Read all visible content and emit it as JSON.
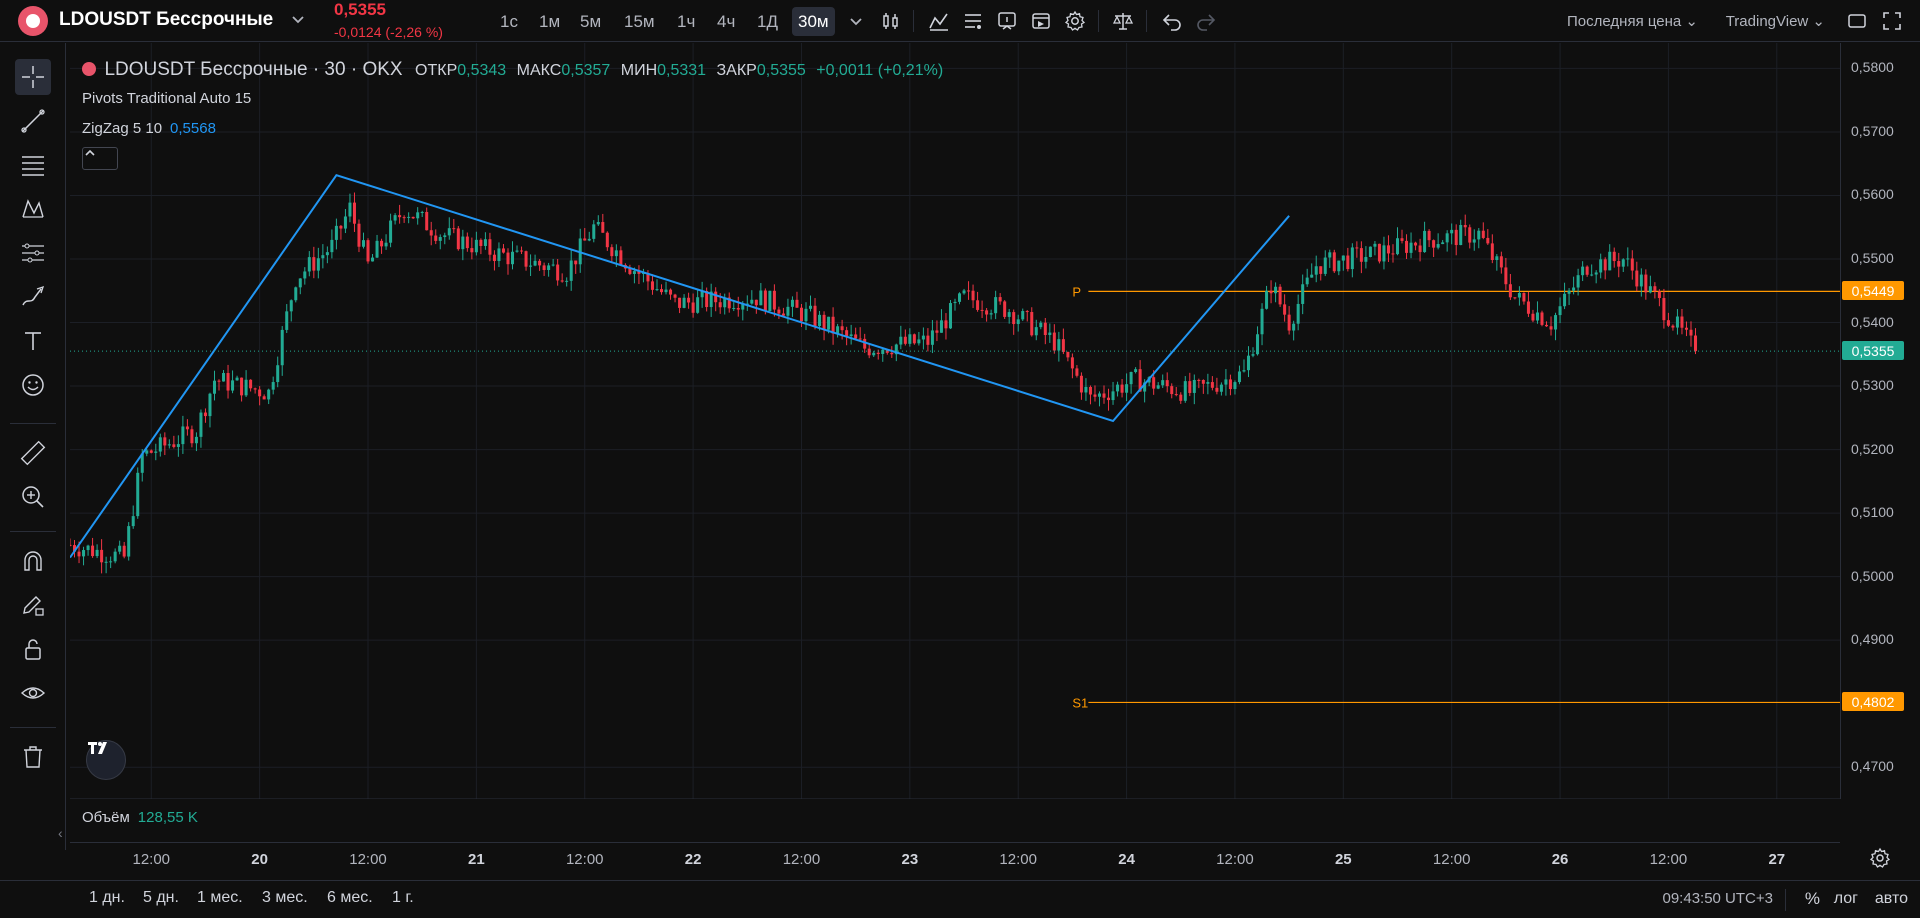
{
  "header": {
    "symbol": "LDOUSDT Бессрочные",
    "last_price": "0,5355",
    "price_change": "-0,0124 (-2,26 %)",
    "timeframes": [
      "1с",
      "1м",
      "5м",
      "15м",
      "1ч",
      "4ч",
      "1Д",
      "30м"
    ],
    "active_timeframe": "30м",
    "price_type": "Последняя цена",
    "provider": "TradingView"
  },
  "legend": {
    "symbol_line": "LDOUSDT Бессрочные · 30 · OKX",
    "open_label": "ОТКР",
    "open_value": "0,5343",
    "high_label": "МАКС",
    "high_value": "0,5357",
    "low_label": "МИН",
    "low_value": "0,5331",
    "close_label": "ЗАКР",
    "close_value": "0,5355",
    "change": "+0,0011 (+0,21%)",
    "pivots": "Pivots Traditional Auto 15",
    "zigzag": "ZigZag 5 10",
    "zigzag_value": "0,5568",
    "pivot_p_label": "P",
    "pivot_s1_label": "S1"
  },
  "volume": {
    "label": "Объём",
    "value": "128,55 K"
  },
  "price_axis": {
    "ticks": [
      "0,5800",
      "0,5700",
      "0,5600",
      "0,5500",
      "0,5400",
      "0,5300",
      "0,5200",
      "0,5100",
      "0,5000",
      "0,4900",
      "0,4700"
    ],
    "pivot_p": "0,5449",
    "current": "0,5355",
    "pivot_s1": "0,4802"
  },
  "time_axis": {
    "labels": [
      "12:00",
      "20",
      "12:00",
      "21",
      "12:00",
      "22",
      "12:00",
      "23",
      "12:00",
      "24",
      "12:00",
      "25",
      "12:00",
      "26",
      "12:00",
      "27"
    ]
  },
  "bottom": {
    "ranges": [
      "1 дн.",
      "5 дн.",
      "1 мес.",
      "3 мес.",
      "6 мес.",
      "1 г."
    ],
    "clock": "09:43:50 UTC+3",
    "percent": "%",
    "log": "лог",
    "auto": "авто"
  },
  "colors": {
    "up": "#22ab94",
    "down": "#f23645",
    "zigzag": "#2196f3",
    "pivot": "#ff9800",
    "background": "#0f0f0f"
  },
  "chart_data": {
    "type": "line",
    "price_range": [
      0.465,
      0.584
    ],
    "time_range_hours": [
      0,
      196
    ],
    "zigzag_points": [
      {
        "t": 0,
        "price": 0.503
      },
      {
        "t": 29.5,
        "price": 0.5632
      },
      {
        "t": 115.5,
        "price": 0.5245
      },
      {
        "t": 135,
        "price": 0.5568
      }
    ],
    "pivot_levels": [
      {
        "name": "P",
        "price": 0.5449
      },
      {
        "name": "S1",
        "price": 0.4802
      }
    ],
    "current_price": 0.5355,
    "candle_anchors": [
      [
        0,
        0.505
      ],
      [
        6,
        0.503
      ],
      [
        8,
        0.519
      ],
      [
        14,
        0.523
      ],
      [
        16,
        0.531
      ],
      [
        22,
        0.529
      ],
      [
        25,
        0.547
      ],
      [
        29,
        0.552
      ],
      [
        31,
        0.558
      ],
      [
        33,
        0.549
      ],
      [
        37,
        0.558
      ],
      [
        41,
        0.554
      ],
      [
        47,
        0.551
      ],
      [
        55,
        0.548
      ],
      [
        58,
        0.555
      ],
      [
        62,
        0.549
      ],
      [
        67,
        0.543
      ],
      [
        76,
        0.544
      ],
      [
        82,
        0.541
      ],
      [
        88,
        0.536
      ],
      [
        95,
        0.537
      ],
      [
        99,
        0.544
      ],
      [
        104,
        0.542
      ],
      [
        109,
        0.537
      ],
      [
        113,
        0.528
      ],
      [
        118,
        0.531
      ],
      [
        124,
        0.529
      ],
      [
        130,
        0.532
      ],
      [
        133,
        0.546
      ],
      [
        135,
        0.54
      ],
      [
        138,
        0.549
      ],
      [
        145,
        0.551
      ],
      [
        150,
        0.553
      ],
      [
        156,
        0.554
      ],
      [
        160,
        0.544
      ],
      [
        164,
        0.54
      ],
      [
        168,
        0.549
      ],
      [
        172,
        0.55
      ],
      [
        176,
        0.543
      ],
      [
        180,
        0.5355
      ]
    ]
  }
}
